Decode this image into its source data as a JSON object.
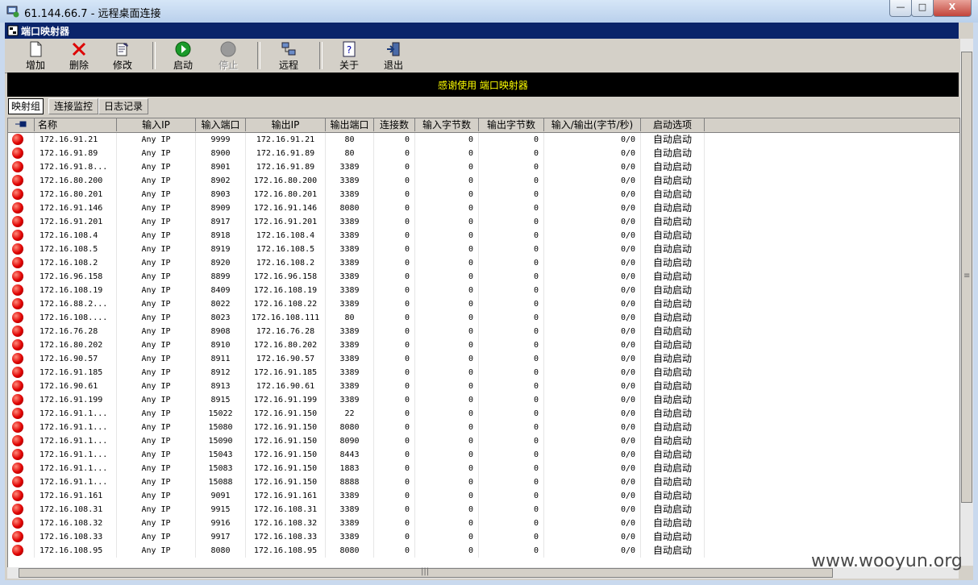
{
  "window": {
    "title": "61.144.66.7 - 远程桌面连接",
    "minimize": "—",
    "maximize": "□",
    "close": "X"
  },
  "app": {
    "title": "端口映射器"
  },
  "toolbar": [
    {
      "label": "增加",
      "icon": "add-icon"
    },
    {
      "label": "删除",
      "icon": "delete-icon"
    },
    {
      "label": "修改",
      "icon": "edit-icon"
    },
    {
      "label": "启动",
      "icon": "start-icon"
    },
    {
      "label": "停止",
      "icon": "stop-icon"
    },
    {
      "label": "远程",
      "icon": "remote-icon"
    },
    {
      "label": "关于",
      "icon": "about-icon"
    },
    {
      "label": "退出",
      "icon": "exit-icon"
    }
  ],
  "banner": {
    "text": "感谢使用 端口映射器"
  },
  "tabs": [
    "映射组",
    "连接监控",
    "日志记录"
  ],
  "columns": [
    "",
    "名称",
    "输入IP",
    "输入端口",
    "输出IP",
    "输出端口",
    "连接数",
    "输入字节数",
    "输出字节数",
    "输入/输出(字节/秒)",
    "启动选项"
  ],
  "rows": [
    [
      "172.16.91.21",
      "Any IP",
      "9999",
      "172.16.91.21",
      "80",
      "0",
      "0",
      "0",
      "0/0",
      "自动启动"
    ],
    [
      "172.16.91.89",
      "Any IP",
      "8900",
      "172.16.91.89",
      "80",
      "0",
      "0",
      "0",
      "0/0",
      "自动启动"
    ],
    [
      "172.16.91.8...",
      "Any IP",
      "8901",
      "172.16.91.89",
      "3389",
      "0",
      "0",
      "0",
      "0/0",
      "自动启动"
    ],
    [
      "172.16.80.200",
      "Any IP",
      "8902",
      "172.16.80.200",
      "3389",
      "0",
      "0",
      "0",
      "0/0",
      "自动启动"
    ],
    [
      "172.16.80.201",
      "Any IP",
      "8903",
      "172.16.80.201",
      "3389",
      "0",
      "0",
      "0",
      "0/0",
      "自动启动"
    ],
    [
      "172.16.91.146",
      "Any IP",
      "8909",
      "172.16.91.146",
      "8080",
      "0",
      "0",
      "0",
      "0/0",
      "自动启动"
    ],
    [
      "172.16.91.201",
      "Any IP",
      "8917",
      "172.16.91.201",
      "3389",
      "0",
      "0",
      "0",
      "0/0",
      "自动启动"
    ],
    [
      "172.16.108.4",
      "Any IP",
      "8918",
      "172.16.108.4",
      "3389",
      "0",
      "0",
      "0",
      "0/0",
      "自动启动"
    ],
    [
      "172.16.108.5",
      "Any IP",
      "8919",
      "172.16.108.5",
      "3389",
      "0",
      "0",
      "0",
      "0/0",
      "自动启动"
    ],
    [
      "172.16.108.2",
      "Any IP",
      "8920",
      "172.16.108.2",
      "3389",
      "0",
      "0",
      "0",
      "0/0",
      "自动启动"
    ],
    [
      "172.16.96.158",
      "Any IP",
      "8899",
      "172.16.96.158",
      "3389",
      "0",
      "0",
      "0",
      "0/0",
      "自动启动"
    ],
    [
      "172.16.108.19",
      "Any IP",
      "8409",
      "172.16.108.19",
      "3389",
      "0",
      "0",
      "0",
      "0/0",
      "自动启动"
    ],
    [
      "172.16.88.2...",
      "Any IP",
      "8022",
      "172.16.108.22",
      "3389",
      "0",
      "0",
      "0",
      "0/0",
      "自动启动"
    ],
    [
      "172.16.108....",
      "Any IP",
      "8023",
      "172.16.108.111",
      "80",
      "0",
      "0",
      "0",
      "0/0",
      "自动启动"
    ],
    [
      "172.16.76.28",
      "Any IP",
      "8908",
      "172.16.76.28",
      "3389",
      "0",
      "0",
      "0",
      "0/0",
      "自动启动"
    ],
    [
      "172.16.80.202",
      "Any IP",
      "8910",
      "172.16.80.202",
      "3389",
      "0",
      "0",
      "0",
      "0/0",
      "自动启动"
    ],
    [
      "172.16.90.57",
      "Any IP",
      "8911",
      "172.16.90.57",
      "3389",
      "0",
      "0",
      "0",
      "0/0",
      "自动启动"
    ],
    [
      "172.16.91.185",
      "Any IP",
      "8912",
      "172.16.91.185",
      "3389",
      "0",
      "0",
      "0",
      "0/0",
      "自动启动"
    ],
    [
      "172.16.90.61",
      "Any IP",
      "8913",
      "172.16.90.61",
      "3389",
      "0",
      "0",
      "0",
      "0/0",
      "自动启动"
    ],
    [
      "172.16.91.199",
      "Any IP",
      "8915",
      "172.16.91.199",
      "3389",
      "0",
      "0",
      "0",
      "0/0",
      "自动启动"
    ],
    [
      "172.16.91.1...",
      "Any IP",
      "15022",
      "172.16.91.150",
      "22",
      "0",
      "0",
      "0",
      "0/0",
      "自动启动"
    ],
    [
      "172.16.91.1...",
      "Any IP",
      "15080",
      "172.16.91.150",
      "8080",
      "0",
      "0",
      "0",
      "0/0",
      "自动启动"
    ],
    [
      "172.16.91.1...",
      "Any IP",
      "15090",
      "172.16.91.150",
      "8090",
      "0",
      "0",
      "0",
      "0/0",
      "自动启动"
    ],
    [
      "172.16.91.1...",
      "Any IP",
      "15043",
      "172.16.91.150",
      "8443",
      "0",
      "0",
      "0",
      "0/0",
      "自动启动"
    ],
    [
      "172.16.91.1...",
      "Any IP",
      "15083",
      "172.16.91.150",
      "1883",
      "0",
      "0",
      "0",
      "0/0",
      "自动启动"
    ],
    [
      "172.16.91.1...",
      "Any IP",
      "15088",
      "172.16.91.150",
      "8888",
      "0",
      "0",
      "0",
      "0/0",
      "自动启动"
    ],
    [
      "172.16.91.161",
      "Any IP",
      "9091",
      "172.16.91.161",
      "3389",
      "0",
      "0",
      "0",
      "0/0",
      "自动启动"
    ],
    [
      "172.16.108.31",
      "Any IP",
      "9915",
      "172.16.108.31",
      "3389",
      "0",
      "0",
      "0",
      "0/0",
      "自动启动"
    ],
    [
      "172.16.108.32",
      "Any IP",
      "9916",
      "172.16.108.32",
      "3389",
      "0",
      "0",
      "0",
      "0/0",
      "自动启动"
    ],
    [
      "172.16.108.33",
      "Any IP",
      "9917",
      "172.16.108.33",
      "3389",
      "0",
      "0",
      "0",
      "0/0",
      "自动启动"
    ],
    [
      "172.16.108.95",
      "Any IP",
      "8080",
      "172.16.108.95",
      "8080",
      "0",
      "0",
      "0",
      "0/0",
      "自动启动"
    ]
  ],
  "scrollbar": {
    "grip": "|||",
    "vgrip": "≡"
  },
  "watermark": "www.wooyun.org"
}
